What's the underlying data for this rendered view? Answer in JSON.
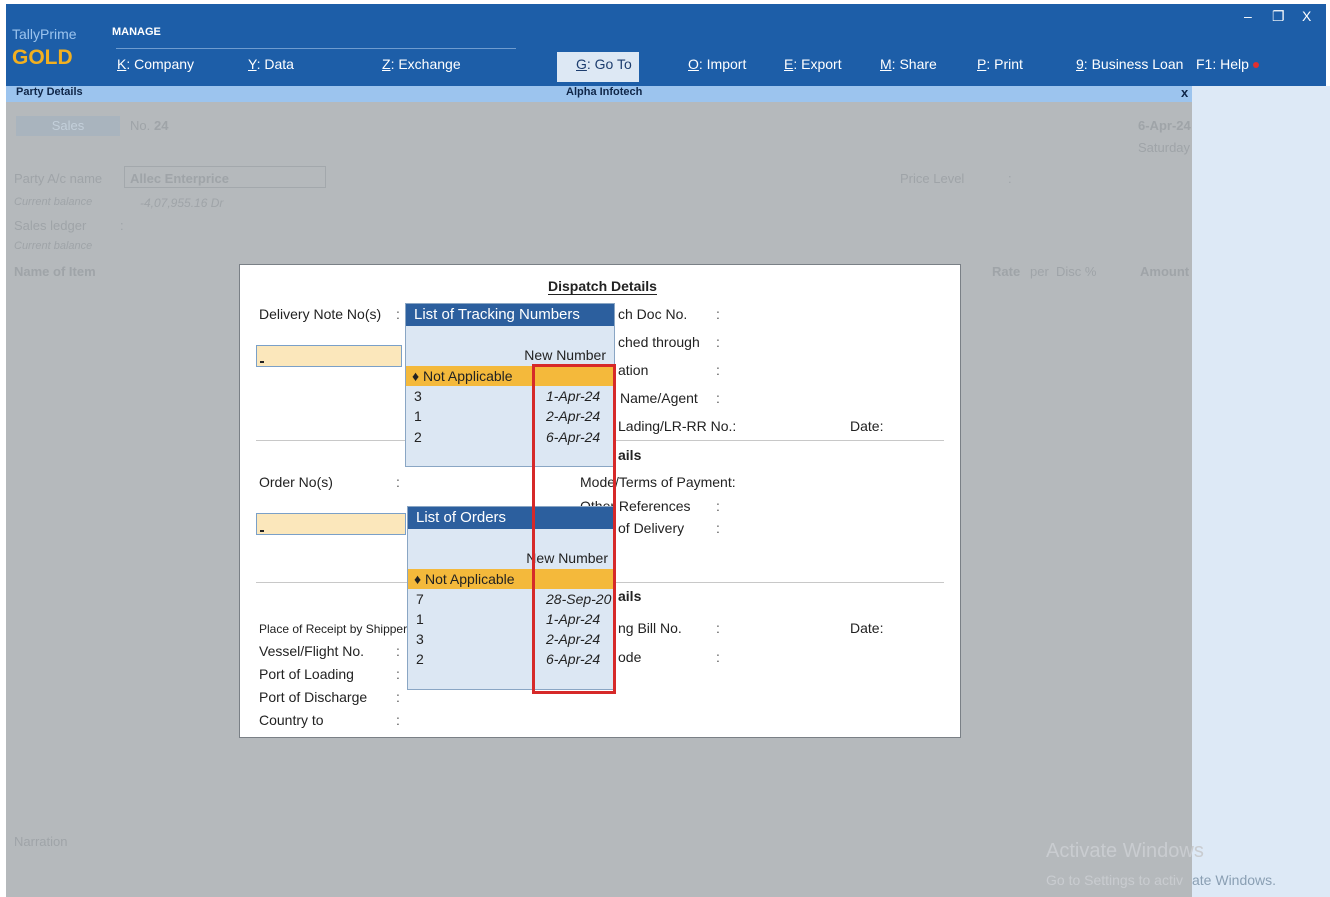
{
  "app": {
    "brand_small": "TallyPrime",
    "brand_big": "GOLD",
    "manage_label": "MANAGE"
  },
  "menu": [
    {
      "key": "K",
      "label": ": Company"
    },
    {
      "key": "Y",
      "label": ": Data"
    },
    {
      "key": "Z",
      "label": ": Exchange"
    },
    {
      "key": "G",
      "label": ": Go To"
    },
    {
      "key": "O",
      "label": ": Import"
    },
    {
      "key": "E",
      "label": ": Export"
    },
    {
      "key": "M",
      "label": ": Share"
    },
    {
      "key": "P",
      "label": ": Print"
    },
    {
      "key": "9",
      "label": ": Business Loan"
    },
    {
      "key": "F1",
      "label": ": Help"
    }
  ],
  "window_controls": {
    "minimize": "–",
    "restore": "❐",
    "close": "X"
  },
  "strip": {
    "left": "Party Details",
    "center": "Alpha Infotech",
    "close": "x"
  },
  "voucher": {
    "type": "Sales",
    "no_label": "No.",
    "no_value": "24",
    "date": "6-Apr-24",
    "day": "Saturday",
    "party_label": "Party A/c name",
    "party_value": "Allec Enterprice",
    "current_balance_label": "Current balance",
    "current_balance_value": "-4,07,955.16 Dr",
    "sales_ledger_label": "Sales ledger",
    "sales_ledger_colon": ":",
    "current_balance2_label": "Current balance",
    "price_level_label": "Price Level",
    "price_level_colon": ":",
    "item_header": "Name of Item",
    "rate_header": "Rate",
    "per_header": "per",
    "disc_header": "Disc %",
    "amount_header": "Amount",
    "narration_label": "Narration"
  },
  "dialog": {
    "title": "Dispatch Details",
    "delivery_note_label": "Delivery Note No(s)",
    "colon": ":",
    "dispatch_doc_label": "ch Doc No.",
    "dispatched_through_label": "ched through",
    "destination_label": "ation",
    "carrier_label": "Name/Agent",
    "bill_of_lading_label": "Lading/LR-RR No.:",
    "date_label": "Date:",
    "order_details_label": "ails",
    "order_no_label": "Order No(s)",
    "mode_label": "Mode/Terms of Payment:",
    "other_ref_label": "Other References",
    "terms_delivery_label": "of Delivery",
    "export_details_label": "ails",
    "shipping_bill_label": "ng Bill No.",
    "shipping_date_label": "Date:",
    "port_code_label": "ode",
    "place_receipt_label": "Place of Receipt by Shipper:",
    "vessel_label": "Vessel/Flight No.",
    "port_loading_label": "Port of Loading",
    "port_discharge_label": "Port of Discharge",
    "country_label": "Country to"
  },
  "tracking_list": {
    "title": "List of Tracking Numbers",
    "new_number": "New Number",
    "selected": "♦ Not Applicable",
    "rows": [
      {
        "num": "3",
        "date": "1-Apr-24"
      },
      {
        "num": "1",
        "date": "2-Apr-24"
      },
      {
        "num": "2",
        "date": "6-Apr-24"
      }
    ]
  },
  "orders_list": {
    "title": "List of Orders",
    "new_number": "New Number",
    "selected": "♦ Not Applicable",
    "rows": [
      {
        "num": "7",
        "date": "28-Sep-20"
      },
      {
        "num": "1",
        "date": "1-Apr-24"
      },
      {
        "num": "3",
        "date": "2-Apr-24"
      },
      {
        "num": "2",
        "date": "6-Apr-24"
      }
    ]
  },
  "watermark": {
    "title": "Activate Windows",
    "subtitle": "Go to Settings to activ",
    "subtitle_tail": "ate Windows."
  },
  "colors": {
    "menu_bar": "#1d5ea8",
    "brand_gold": "#f2b020",
    "selection": "#f4b93b",
    "highlight_box": "#d62929",
    "input_fill": "#fbe7bb"
  }
}
